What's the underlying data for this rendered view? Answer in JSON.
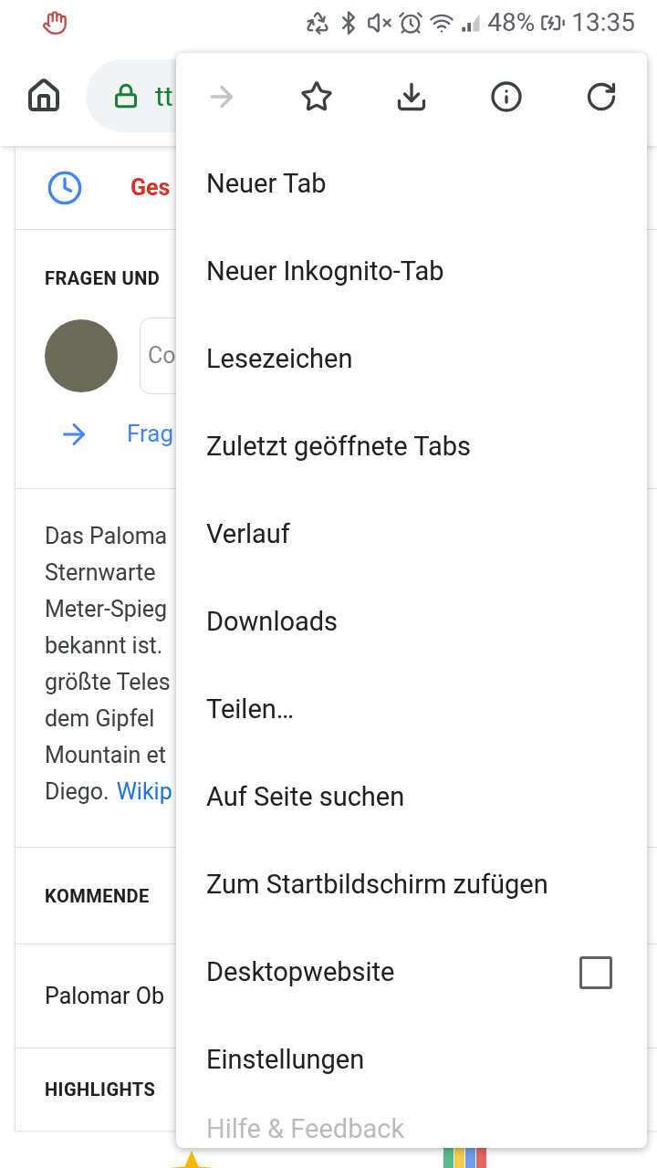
{
  "status_bar": {
    "battery": "48%",
    "time": "13:35"
  },
  "address_bar": {
    "url": "tt"
  },
  "page": {
    "tab_label": "Ges",
    "qa_heading": "FRAGEN UND",
    "comment_placeholder": "Co",
    "ask_link": "Frag",
    "description": {
      "lines": [
        "Das Paloma",
        "Sternwarte",
        "Meter-Spieg",
        "bekannt ist.",
        "größte Teles",
        "dem Gipfel",
        "Mountain et",
        "Diego."
      ],
      "link": "Wikip"
    },
    "upcoming_heading": "KOMMENDE",
    "upcoming_item": "Palomar Ob",
    "highlights_heading": "HIGHLIGHTS"
  },
  "menu": {
    "toolbar": [
      {
        "kind": "forward",
        "disabled": true
      },
      {
        "kind": "bookmark",
        "disabled": false
      },
      {
        "kind": "download",
        "disabled": false
      },
      {
        "kind": "info",
        "disabled": false
      },
      {
        "kind": "reload",
        "disabled": false
      }
    ],
    "items": [
      {
        "label": "Neuer Tab"
      },
      {
        "label": "Neuer Inkognito-Tab"
      },
      {
        "label": "Lesezeichen"
      },
      {
        "label": "Zuletzt geöffnete Tabs"
      },
      {
        "label": "Verlauf"
      },
      {
        "label": "Downloads"
      },
      {
        "label": "Teilen…"
      },
      {
        "label": "Auf Seite suchen"
      },
      {
        "label": "Zum Startbildschirm zufügen"
      },
      {
        "label": "Desktopwebsite",
        "checked": false
      },
      {
        "label": "Einstellungen"
      },
      {
        "label": "Hilfe & Feedback",
        "faded": true
      }
    ]
  }
}
